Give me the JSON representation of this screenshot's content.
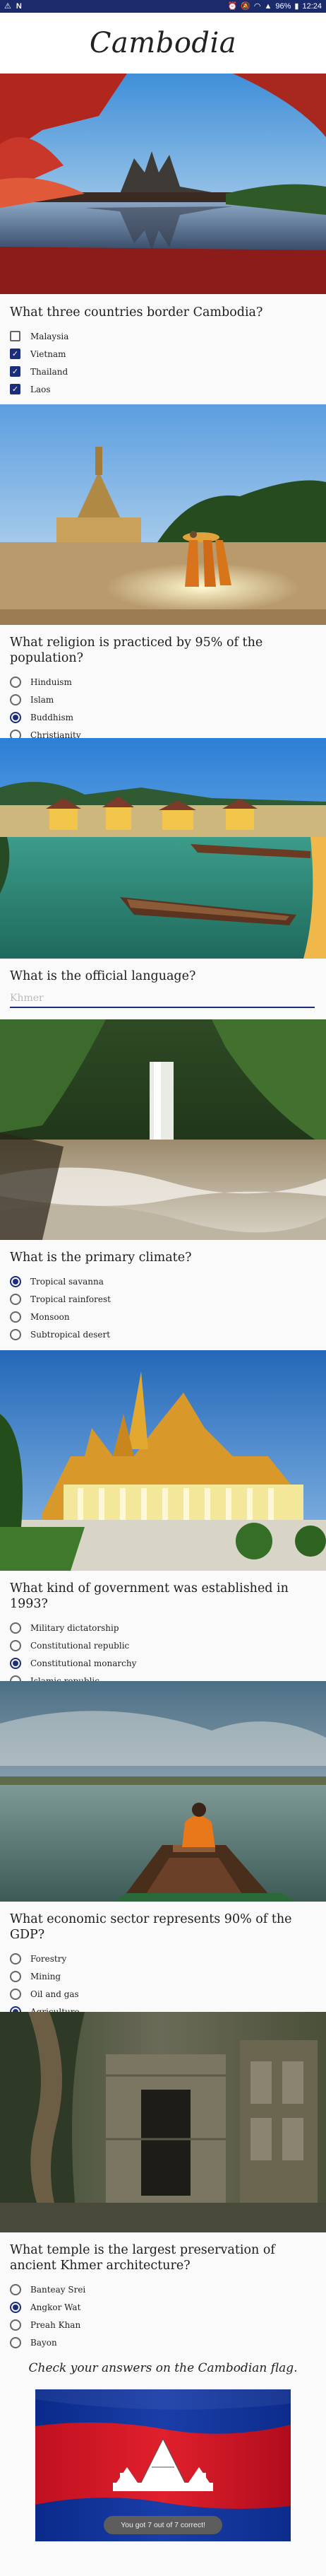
{
  "statusbar": {
    "battery": "96%",
    "time": "12:24"
  },
  "app": {
    "title": "Cambodia"
  },
  "questions": [
    {
      "title": "What three countries border Cambodia?",
      "type": "checkbox",
      "options": [
        {
          "label": "Malaysia",
          "checked": false
        },
        {
          "label": "Vietnam",
          "checked": true
        },
        {
          "label": "Thailand",
          "checked": true
        },
        {
          "label": "Laos",
          "checked": true
        }
      ]
    },
    {
      "title": "What religion is practiced by 95% of the population?",
      "type": "radio",
      "options": [
        {
          "label": "Hinduism",
          "checked": false
        },
        {
          "label": "Islam",
          "checked": false
        },
        {
          "label": "Buddhism",
          "checked": true
        },
        {
          "label": "Christianity",
          "checked": false
        }
      ]
    },
    {
      "title": "What is the official language?",
      "type": "text",
      "value": "Khmer"
    },
    {
      "title": "What is the primary climate?",
      "type": "radio",
      "options": [
        {
          "label": "Tropical savanna",
          "checked": true
        },
        {
          "label": "Tropical rainforest",
          "checked": false
        },
        {
          "label": "Monsoon",
          "checked": false
        },
        {
          "label": "Subtropical desert",
          "checked": false
        }
      ]
    },
    {
      "title": "What kind of government was established in 1993?",
      "type": "radio",
      "options": [
        {
          "label": "Military dictatorship",
          "checked": false
        },
        {
          "label": "Constitutional republic",
          "checked": false
        },
        {
          "label": "Constitutional monarchy",
          "checked": true
        },
        {
          "label": "Islamic republic",
          "checked": false
        }
      ]
    },
    {
      "title": "What economic sector represents 90% of the GDP?",
      "type": "radio",
      "options": [
        {
          "label": "Forestry",
          "checked": false
        },
        {
          "label": "Mining",
          "checked": false
        },
        {
          "label": "Oil and gas",
          "checked": false
        },
        {
          "label": "Agriculture",
          "checked": true
        }
      ]
    },
    {
      "title": "What temple is the largest preservation of ancient Khmer architecture?",
      "type": "radio",
      "options": [
        {
          "label": "Banteay Srei",
          "checked": false
        },
        {
          "label": "Angkor Wat",
          "checked": true
        },
        {
          "label": "Preah Khan",
          "checked": false
        },
        {
          "label": "Bayon",
          "checked": false
        }
      ]
    }
  ],
  "flag_caption": "Check your answers on the Cambodian flag.",
  "toast": "You got 7 out of 7 correct!"
}
